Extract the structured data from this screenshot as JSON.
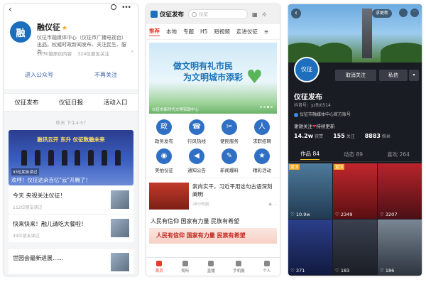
{
  "panel1": {
    "account_name": "融仪征",
    "logo_text": "融",
    "description": "仪征市融媒体中心（仪征市广播电视台）出品，权威时政新闻发布、关注民生、服务...",
    "stats": [
      "1230篇原创内容",
      "324位朋友关注"
    ],
    "actions": [
      "进入公众号",
      "不再关注"
    ],
    "menu": [
      "仪征发布",
      "仪征日报",
      "活动入口"
    ],
    "timestamp": "昨天 下午4:57",
    "hero": {
      "title": "融讯云开 东升 仪征数融未来",
      "badge": "93位朋友读过",
      "caption": "欢呼！仪征这朵百亿\"云\"开腾了！"
    },
    "articles": [
      {
        "title": "今天 央视关注仪征！",
        "meta": "112位朋友读过"
      },
      {
        "title": "快来快来！融儿请吃大餐啦！",
        "meta": "49位朋友读过"
      },
      {
        "title": "世园会最新进展......",
        "meta": ""
      }
    ]
  },
  "panel2": {
    "app_name": "仪征发布",
    "search_placeholder": "仪征",
    "tabs": [
      "推荐",
      "本地",
      "专题",
      "H5",
      "短视频",
      "走进仪征"
    ],
    "banner": {
      "line1": "做文明有礼市民",
      "line2": "为文明城市添彩",
      "caption": "仪征市新时代文明实践中心"
    },
    "grid": [
      {
        "label": "政务发布",
        "icon": "政"
      },
      {
        "label": "行风热线",
        "icon": "☎"
      },
      {
        "label": "便民服务",
        "icon": "✂"
      },
      {
        "label": "求职招聘",
        "icon": "人"
      },
      {
        "label": "美拍仪征",
        "icon": "◉"
      },
      {
        "label": "通知公告",
        "icon": "◀"
      },
      {
        "label": "新闻爆料",
        "icon": "✎"
      },
      {
        "label": "精彩活动",
        "icon": "★"
      }
    ],
    "news": {
      "title": "崇尚实干，习近平用这句古语深刻阐明",
      "meta": "28小时前",
      "views": "..."
    },
    "headline": "人民有信仰 国家有力量 民族有希望",
    "strip": "人民有信仰 国家有力量 民族有希望",
    "bottom_nav": [
      "首页",
      "视听",
      "直播",
      "手机报",
      "个人"
    ]
  },
  "panel3": {
    "new_label": "求更新",
    "logo_text": "仪征",
    "follow_btn": "取消关注",
    "message_btn": "私信",
    "name": "仪征发布",
    "id": "抖音号：yzfb0514",
    "verified": "仪征市融媒体中心官方账号",
    "bio_prefix": "谢谢关注",
    "bio_suffix": "持续更新",
    "stats": [
      {
        "value": "14.2w",
        "label": "获赞"
      },
      {
        "value": "155",
        "label": "关注"
      },
      {
        "value": "8883",
        "label": "粉丝"
      }
    ],
    "tabs": [
      "作品 84",
      "动态 89",
      "喜欢 264"
    ],
    "videos": [
      {
        "tag": "置顶",
        "count": "10.9w"
      },
      {
        "tag": "置顶",
        "count": "2349"
      },
      {
        "tag": "",
        "count": "3207"
      },
      {
        "tag": "",
        "count": "371"
      },
      {
        "tag": "",
        "count": "183"
      },
      {
        "tag": "",
        "count": "186"
      }
    ],
    "colors": {
      "accent": "#f5c518",
      "heart": "#e0354a"
    }
  }
}
